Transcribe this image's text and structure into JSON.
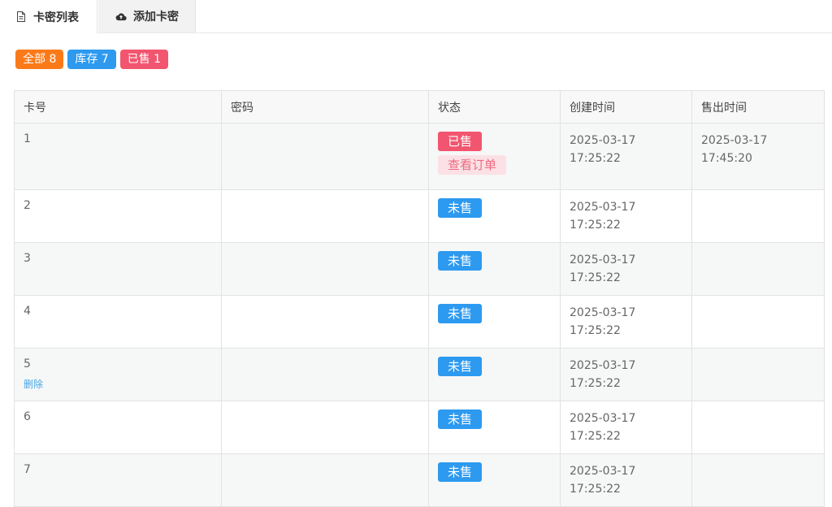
{
  "tabs": [
    {
      "label": "卡密列表",
      "icon": "document-icon"
    },
    {
      "label": "添加卡密",
      "icon": "cloud-upload-icon"
    }
  ],
  "badges": {
    "all": {
      "label": "全部 8",
      "color": "#fa7a1a"
    },
    "stock": {
      "label": "库存 7",
      "color": "#2d9af0"
    },
    "sold": {
      "label": "已售 1",
      "color": "#f2556f"
    }
  },
  "table": {
    "headers": [
      "卡号",
      "密码",
      "状态",
      "创建时间",
      "售出时间"
    ],
    "rows": [
      {
        "card": "1",
        "password": "",
        "status": "已售",
        "action": "查看订单",
        "created_date": "2025-03-17",
        "created_time": "17:25:22",
        "sold_date": "2025-03-17",
        "sold_time": "17:45:20"
      },
      {
        "card": "2",
        "password": "",
        "status": "未售",
        "created_date": "2025-03-17",
        "created_time": "17:25:22"
      },
      {
        "card": "3",
        "password": "",
        "status": "未售",
        "created_date": "2025-03-17",
        "created_time": "17:25:22"
      },
      {
        "card": "4",
        "password": "",
        "status": "未售",
        "created_date": "2025-03-17",
        "created_time": "17:25:22"
      },
      {
        "card": "5",
        "password": "",
        "status": "未售",
        "delete": "删除",
        "created_date": "2025-03-17",
        "created_time": "17:25:22"
      },
      {
        "card": "6",
        "password": "",
        "status": "未售",
        "created_date": "2025-03-17",
        "created_time": "17:25:22"
      },
      {
        "card": "7",
        "password": "",
        "status": "未售",
        "created_date": "2025-03-17",
        "created_time": "17:25:22"
      }
    ]
  },
  "colors": {
    "sold": "#f2556f",
    "unsold": "#2d9af0",
    "all": "#fa7a1a",
    "link": "#4aa6e6"
  }
}
